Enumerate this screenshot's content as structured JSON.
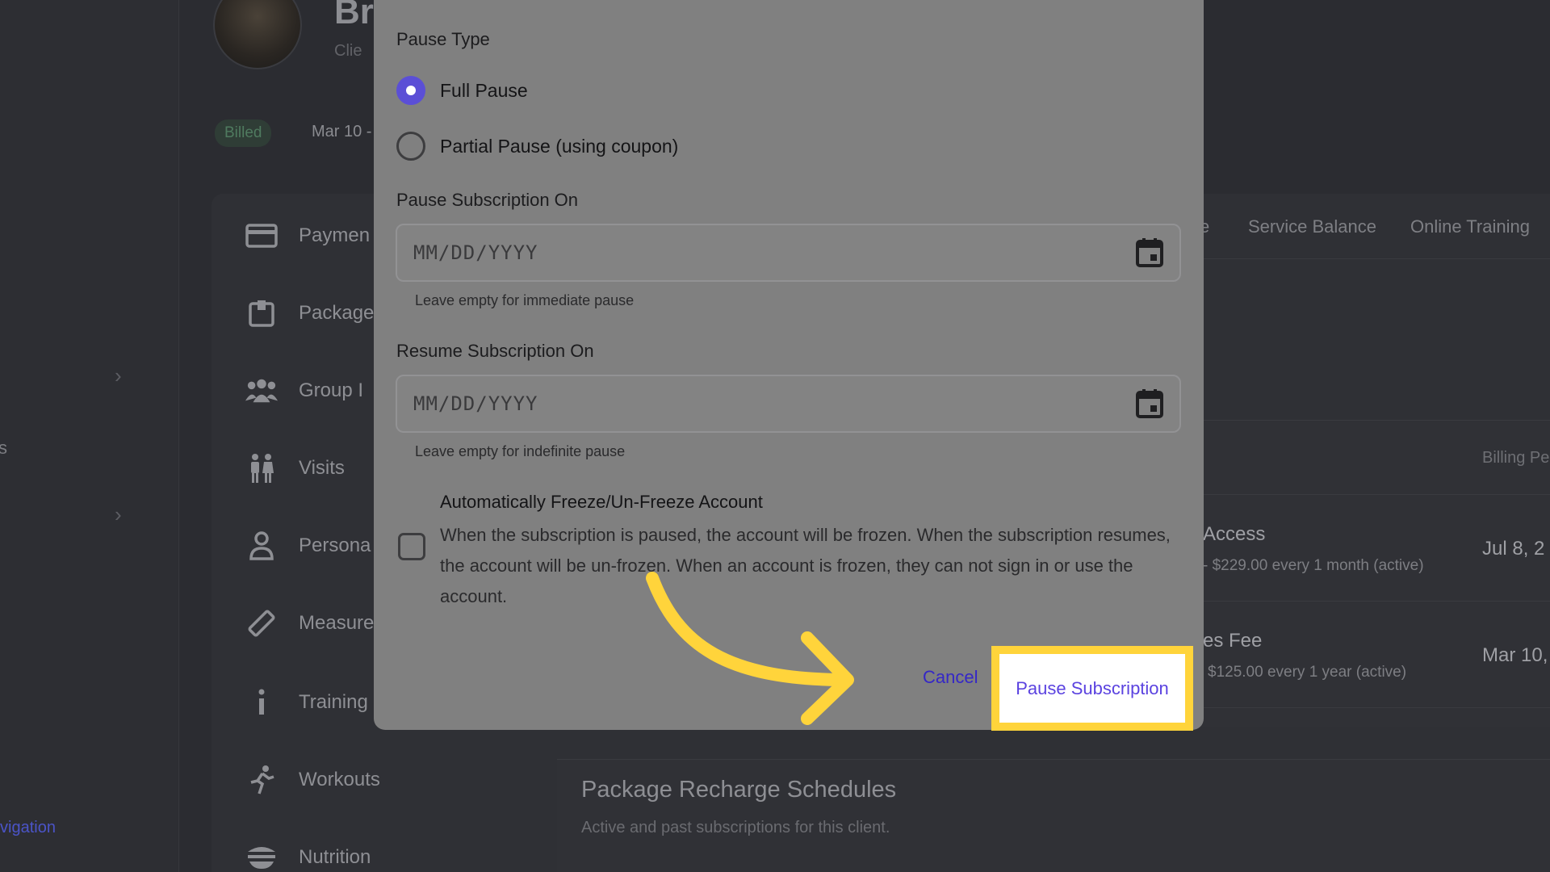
{
  "background": {
    "client_name_fragment": "Br",
    "client_role_fragment": "Clie",
    "status_badge": "Billed",
    "date_fragment": "Mar 10 -",
    "menu_items": [
      {
        "label": "Paymen",
        "icon": "credit-card-icon"
      },
      {
        "label": "Package",
        "icon": "package-icon"
      },
      {
        "label": "Group I",
        "icon": "group-icon"
      },
      {
        "label": "Visits",
        "icon": "visits-icon"
      },
      {
        "label": "Persona",
        "icon": "person-icon"
      },
      {
        "label": "Measure",
        "icon": "ruler-icon"
      },
      {
        "label": "Training",
        "icon": "info-icon"
      },
      {
        "label": "Workouts",
        "icon": "running-icon"
      },
      {
        "label": "Nutrition",
        "icon": "bowl-icon"
      }
    ],
    "tabs": [
      "Service Balance",
      "Online Training"
    ],
    "tab_fragment": "e",
    "left_nav_link": "vigation",
    "left_nav_fragment": "s",
    "table": {
      "column_header": "Billing Pe",
      "rows": [
        {
          "title": "Access",
          "subtitle": "- $229.00 every 1 month (active)",
          "date": "Jul 8, 2"
        },
        {
          "title": "es Fee",
          "subtitle": "$125.00 every 1 year (active)",
          "date": "Mar 10,"
        }
      ]
    },
    "recharge": {
      "title": "Package Recharge Schedules",
      "subtitle": "Active and past subscriptions for this client."
    }
  },
  "modal": {
    "pause_type_label": "Pause Type",
    "pause_options": [
      {
        "label": "Full Pause",
        "checked": true
      },
      {
        "label": "Partial Pause (using coupon)",
        "checked": false
      }
    ],
    "pause_on": {
      "label": "Pause Subscription On",
      "placeholder": "MM/DD/YYYY",
      "helper": "Leave empty for immediate pause"
    },
    "resume_on": {
      "label": "Resume Subscription On",
      "placeholder": "MM/DD/YYYY",
      "helper": "Leave empty for indefinite pause"
    },
    "freeze": {
      "title": "Automatically Freeze/Un-Freeze Account",
      "description": "When the subscription is paused, the account will be frozen. When the subscription resumes, the account will be un-frozen. When an account is frozen, they can not sign in or use the account.",
      "checked": false
    },
    "cancel_label": "Cancel",
    "submit_label": "Pause Subscription"
  },
  "colors": {
    "accent": "#5b4fd6",
    "highlight": "#ffd43b",
    "link": "#3527c6"
  }
}
